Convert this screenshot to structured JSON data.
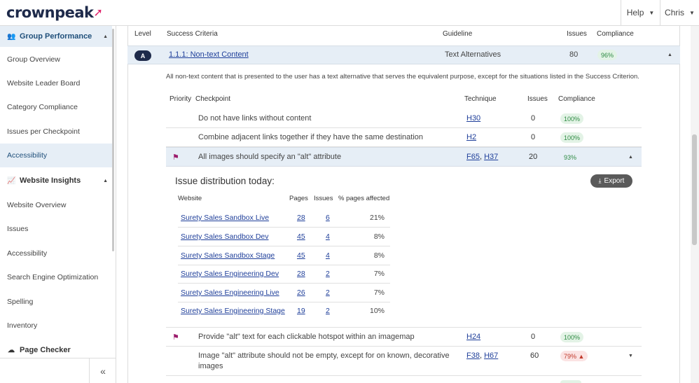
{
  "header": {
    "logo": "crownpeak",
    "help": "Help",
    "user": "Chris"
  },
  "sidebar": {
    "group_performance": "Group Performance",
    "group_items": [
      "Group Overview",
      "Website Leader Board",
      "Category Compliance",
      "Issues per Checkpoint",
      "Accessibility"
    ],
    "website_insights": "Website Insights",
    "insight_items": [
      "Website Overview",
      "Issues",
      "Accessibility",
      "Search Engine Optimization",
      "Spelling",
      "Inventory"
    ],
    "page_checker": "Page Checker",
    "collapse": "«"
  },
  "criteria_table": {
    "headers": {
      "level": "Level",
      "criteria": "Success Criteria",
      "guideline": "Guideline",
      "issues": "Issues",
      "compliance": "Compliance"
    },
    "row": {
      "level": "A",
      "criteria": "1.1.1: Non-text Content",
      "guideline": "Text Alternatives",
      "issues": "80",
      "compliance": "96%"
    },
    "description": "All non-text content that is presented to the user has a text alternative that serves the equivalent purpose, except for the situations listed in the Success Criterion."
  },
  "checkpoints": {
    "headers": {
      "priority": "Priority",
      "checkpoint": "Checkpoint",
      "technique": "Technique",
      "issues": "Issues",
      "compliance": "Compliance"
    },
    "rows": [
      {
        "checkpoint": "Do not have links without content",
        "tech1": "H30",
        "issues": "0",
        "compliance": "100%"
      },
      {
        "checkpoint": "Combine adjacent links together if they have the same destination",
        "tech1": "H2",
        "issues": "0",
        "compliance": "100%"
      },
      {
        "checkpoint": "All images should specify an \"alt\" attribute",
        "tech1": "F65",
        "tech2": "H37",
        "issues": "20",
        "compliance": "93%"
      },
      {
        "checkpoint": "Provide \"alt\" text for each clickable hotspot within an imagemap",
        "tech1": "H24",
        "issues": "0",
        "compliance": "100%"
      },
      {
        "checkpoint": "Image \"alt\" attribute should not be empty, except for on known, decorative",
        "checkpoint_line2": "images",
        "tech1": "F38",
        "tech2": "H67",
        "issues": "60",
        "compliance": "79%"
      }
    ]
  },
  "distribution": {
    "title": "Issue distribution today:",
    "export": "Export",
    "headers": {
      "website": "Website",
      "pages": "Pages",
      "issues": "Issues",
      "pct": "% pages affected"
    },
    "rows": [
      {
        "site": "Surety Sales Sandbox Live",
        "pages": "28",
        "issues": "6",
        "pct": "21%"
      },
      {
        "site": "Surety Sales Sandbox Dev",
        "pages": "45",
        "issues": "4",
        "pct": "8%"
      },
      {
        "site": "Surety Sales Sandbox Stage",
        "pages": "45",
        "issues": "4",
        "pct": "8%"
      },
      {
        "site": "Surety Sales Engineering Dev",
        "pages": "28",
        "issues": "2",
        "pct": "7%"
      },
      {
        "site": "Surety Sales Engineering Live",
        "pages": "26",
        "issues": "2",
        "pct": "7%"
      },
      {
        "site": "Surety Sales Engineering Stage",
        "pages": "19",
        "issues": "2",
        "pct": "10%"
      }
    ]
  },
  "colors": {
    "brand": "#1e2a4a",
    "accent": "#e0246c",
    "active_bg": "#e6eef6",
    "ok": "#2e8b43",
    "warn": "#c0392b",
    "flag": "#9c1c6c"
  }
}
